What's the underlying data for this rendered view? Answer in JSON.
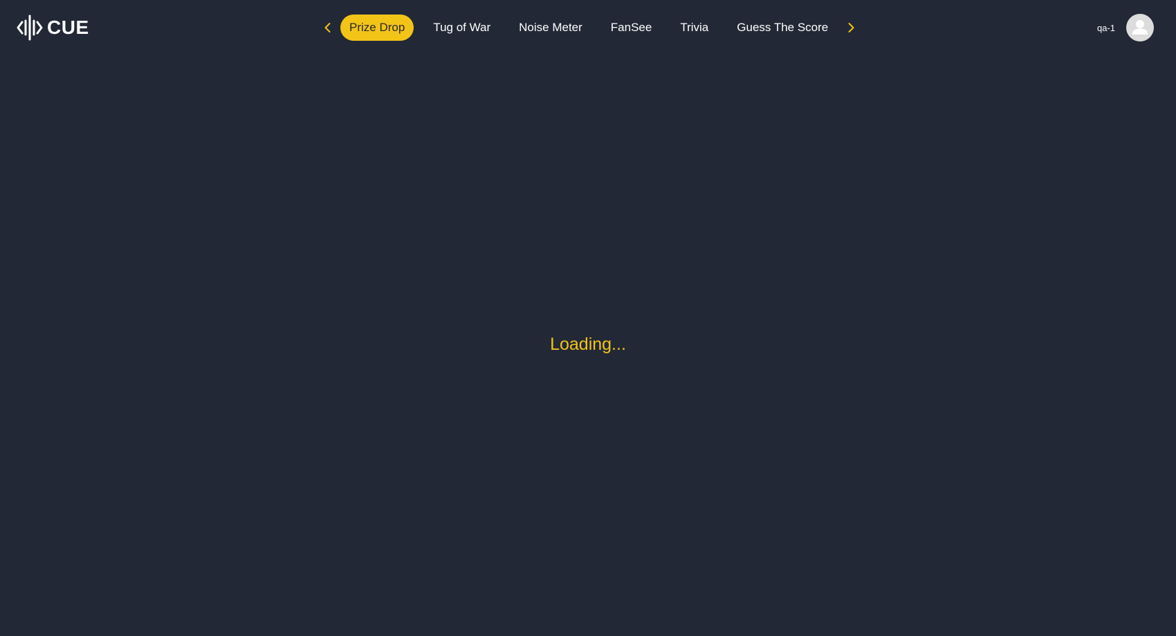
{
  "app": {
    "logo_text": "CUE",
    "logo_icon": "sound-wave-logo-icon"
  },
  "nav": {
    "prev_icon": "chevron-left-icon",
    "next_icon": "chevron-right-icon",
    "tabs": [
      {
        "label": "Prize Drop",
        "active": true
      },
      {
        "label": "Tug of War",
        "active": false
      },
      {
        "label": "Noise Meter",
        "active": false
      },
      {
        "label": "FanSee",
        "active": false
      },
      {
        "label": "Trivia",
        "active": false
      },
      {
        "label": "Guess The Score",
        "active": false
      }
    ]
  },
  "user": {
    "name": "qa-1",
    "avatar_icon": "user-avatar-icon"
  },
  "main": {
    "status_text": "Loading..."
  },
  "colors": {
    "background": "#222835",
    "accent": "#f2c418",
    "text": "#ffffff",
    "avatar_bg": "#dcdcdc"
  }
}
